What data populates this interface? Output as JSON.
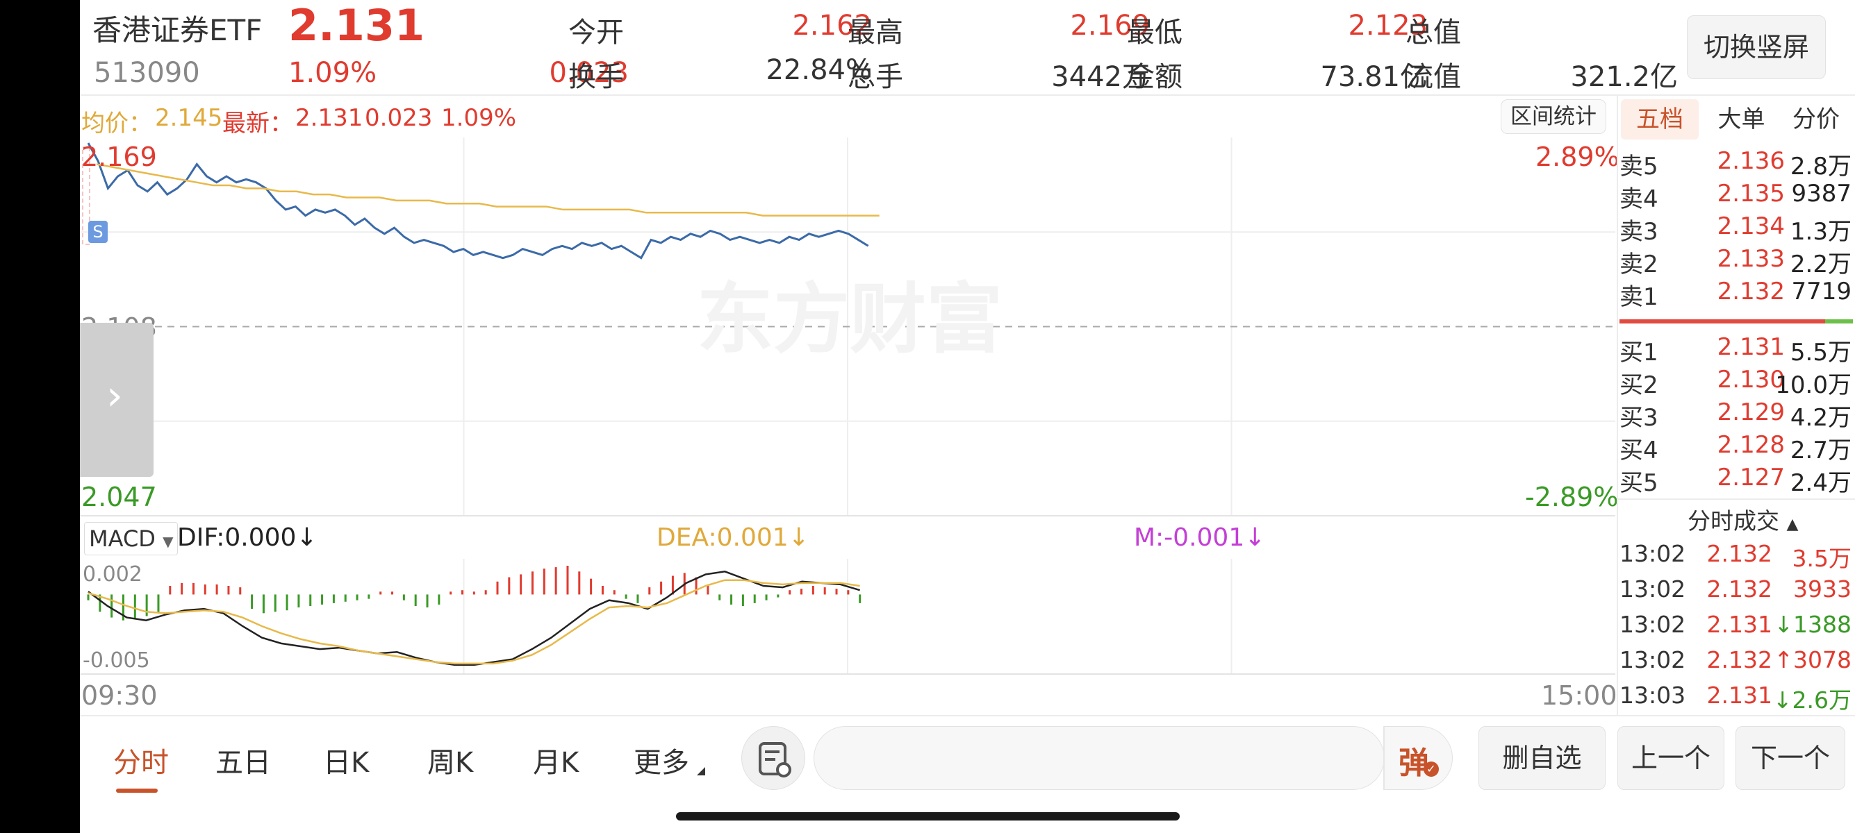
{
  "header": {
    "name": "香港证券ETF",
    "code": "513090",
    "price": "2.131",
    "change_pct": "1.09%",
    "change": "0.023",
    "open_label": "今开",
    "open": "2.162",
    "high_label": "最高",
    "high": "2.169",
    "low_label": "最低",
    "low": "2.123",
    "mktcap_label": "总值",
    "mktcap": "--",
    "turnover_label": "换手",
    "turnover": "22.84%",
    "volume_label": "总手",
    "volume": "3442万",
    "amount_label": "金额",
    "amount": "73.81亿",
    "float_label": "流值",
    "float": "321.2亿",
    "switch_button": "切换竖屏"
  },
  "chart_bar": {
    "avg_label": "均价：",
    "avg": "2.145",
    "latest_label": "最新：",
    "latest": "2.131",
    "change": "0.023",
    "change_pct": "1.09%",
    "range_stats_button": "区间统计",
    "marker": "S"
  },
  "chart_data": [
    {
      "type": "line",
      "ylim": [
        2.047,
        2.169
      ],
      "y_labels": {
        "top": "2.169",
        "mid": "2.108",
        "bottom": "2.047"
      },
      "pct_labels": {
        "top": "2.89%",
        "bottom": "-2.89%"
      },
      "x_labels": {
        "start": "09:30",
        "end": "15:00"
      },
      "grid": true,
      "series": [
        {
          "name": "最新",
          "color": "#3b6aa8",
          "values": [
            2.169,
            2.163,
            2.154,
            2.158,
            2.16,
            2.155,
            2.153,
            2.156,
            2.152,
            2.154,
            2.157,
            2.162,
            2.158,
            2.156,
            2.158,
            2.156,
            2.157,
            2.156,
            2.154,
            2.15,
            2.147,
            2.148,
            2.145,
            2.147,
            2.146,
            2.147,
            2.145,
            2.142,
            2.144,
            2.141,
            2.139,
            2.141,
            2.138,
            2.136,
            2.137,
            2.136,
            2.135,
            2.133,
            2.134,
            2.132,
            2.133,
            2.132,
            2.131,
            2.132,
            2.134,
            2.133,
            2.132,
            2.134,
            2.135,
            2.134,
            2.136,
            2.135,
            2.136,
            2.134,
            2.135,
            2.133,
            2.131,
            2.137,
            2.136,
            2.138,
            2.137,
            2.139,
            2.138,
            2.14,
            2.139,
            2.137,
            2.138,
            2.137,
            2.136,
            2.137,
            2.136,
            2.138,
            2.137,
            2.139,
            2.138,
            2.139,
            2.14,
            2.139,
            2.137,
            2.135
          ]
        },
        {
          "name": "均价",
          "color": "#e8b94a",
          "values": [
            2.162,
            2.161,
            2.16,
            2.159,
            2.158,
            2.157,
            2.156,
            2.155,
            2.155,
            2.154,
            2.154,
            2.153,
            2.153,
            2.152,
            2.152,
            2.151,
            2.151,
            2.151,
            2.15,
            2.15,
            2.15,
            2.149,
            2.149,
            2.149,
            2.148,
            2.148,
            2.148,
            2.148,
            2.147,
            2.147,
            2.147,
            2.147,
            2.147,
            2.146,
            2.146,
            2.146,
            2.146,
            2.146,
            2.146,
            2.146,
            2.145,
            2.145,
            2.145,
            2.145,
            2.145,
            2.145,
            2.145,
            2.145
          ]
        }
      ]
    },
    {
      "type": "bar",
      "name": "MACD",
      "ylim": [
        -0.005,
        0.002
      ],
      "y_labels": {
        "top": "0.002",
        "bottom": "-0.005"
      },
      "selector": "MACD",
      "dif_label": "DIF:0.000↓",
      "dea_label": "DEA:0.001↓",
      "m_label": "M:-0.001↓",
      "histogram": [
        -0.0004,
        -0.0012,
        -0.0016,
        -0.0018,
        -0.0017,
        -0.0015,
        -0.0013,
        0.0006,
        0.0008,
        0.0008,
        0.0007,
        0.0007,
        0.0006,
        0.0005,
        -0.001,
        -0.0013,
        -0.0012,
        -0.0011,
        -0.0009,
        -0.0008,
        -0.0007,
        -0.0006,
        -0.0005,
        -0.0004,
        -0.0003,
        0.0002,
        0.0002,
        -0.0004,
        -0.0008,
        -0.0009,
        -0.0007,
        0.0002,
        0.0003,
        0.0002,
        0.0003,
        0.0009,
        0.0012,
        0.0014,
        0.0016,
        0.0018,
        0.0019,
        0.002,
        0.0016,
        0.0011,
        0.0006,
        0.0003,
        -0.0003,
        -0.0006,
        0.0005,
        0.0009,
        0.0013,
        0.0015,
        0.0012,
        0.0007,
        -0.0004,
        -0.0007,
        -0.0008,
        -0.0006,
        -0.0004,
        -0.0002,
        0.0003,
        0.0004,
        0.0006,
        0.0005,
        0.0004,
        0.0003,
        -0.0006
      ],
      "dif": [
        0.0002,
        -0.0008,
        -0.0016,
        -0.0018,
        -0.0014,
        -0.0011,
        -0.001,
        -0.0013,
        -0.0022,
        -0.003,
        -0.0034,
        -0.0036,
        -0.0038,
        -0.0037,
        -0.0039,
        -0.0041,
        -0.004,
        -0.0044,
        -0.0047,
        -0.0049,
        -0.0049,
        -0.0047,
        -0.0045,
        -0.0038,
        -0.003,
        -0.002,
        -0.001,
        -0.0004,
        -0.0006,
        -0.001,
        -0.0002,
        0.0008,
        0.0014,
        0.0016,
        0.0011,
        0.0006,
        0.0005,
        0.0009,
        0.0008,
        0.0007,
        0.0003
      ],
      "dea": [
        0.0001,
        -0.0003,
        -0.0008,
        -0.0012,
        -0.0013,
        -0.0012,
        -0.0011,
        -0.0012,
        -0.0016,
        -0.0022,
        -0.0027,
        -0.0031,
        -0.0034,
        -0.0036,
        -0.0039,
        -0.0041,
        -0.0043,
        -0.0045,
        -0.0047,
        -0.0048,
        -0.0048,
        -0.0048,
        -0.0046,
        -0.0042,
        -0.0035,
        -0.0026,
        -0.0017,
        -0.0009,
        -0.0008,
        -0.0009,
        -0.0006,
        0.0,
        0.0006,
        0.001,
        0.001,
        0.0008,
        0.0007,
        0.0008,
        0.0008,
        0.0008,
        0.0006
      ]
    }
  ],
  "order_book": {
    "tabs": [
      "五档",
      "大单",
      "分价"
    ],
    "asks": [
      {
        "label": "卖5",
        "price": "2.136",
        "vol": "2.8万"
      },
      {
        "label": "卖4",
        "price": "2.135",
        "vol": "9387"
      },
      {
        "label": "卖3",
        "price": "2.134",
        "vol": "1.3万"
      },
      {
        "label": "卖2",
        "price": "2.133",
        "vol": "2.2万"
      },
      {
        "label": "卖1",
        "price": "2.132",
        "vol": "7719"
      }
    ],
    "ratio": 0.88,
    "bids": [
      {
        "label": "买1",
        "price": "2.131",
        "vol": "5.5万"
      },
      {
        "label": "买2",
        "price": "2.130",
        "vol": "10.0万"
      },
      {
        "label": "买3",
        "price": "2.129",
        "vol": "4.2万"
      },
      {
        "label": "买4",
        "price": "2.128",
        "vol": "2.7万"
      },
      {
        "label": "买5",
        "price": "2.127",
        "vol": "2.4万"
      }
    ],
    "ticks_title": "分时成交",
    "ticks": [
      {
        "time": "13:02",
        "price": "2.132",
        "vol": "3.5万",
        "dir": "up"
      },
      {
        "time": "13:02",
        "price": "2.132",
        "vol": "3933",
        "dir": "up"
      },
      {
        "time": "13:02",
        "price": "2.131",
        "vol": "↓1388",
        "dir": "down"
      },
      {
        "time": "13:02",
        "price": "2.132",
        "vol": "↑3078",
        "dir": "up"
      },
      {
        "time": "13:03",
        "price": "2.131",
        "vol": "↓2.6万",
        "dir": "down"
      }
    ]
  },
  "watermark": "东方财富",
  "bottom": {
    "tabs": [
      "分时",
      "五日",
      "日K",
      "周K",
      "月K",
      "更多"
    ],
    "danmu_button": "弹",
    "remove_fav": "删自选",
    "prev": "上一个",
    "next": "下一个"
  },
  "colors": {
    "up": "#e03b2f",
    "down": "#3a9a26",
    "price_line": "#3b6aa8",
    "avg_line": "#e8b94a",
    "accent": "#c8532a"
  }
}
